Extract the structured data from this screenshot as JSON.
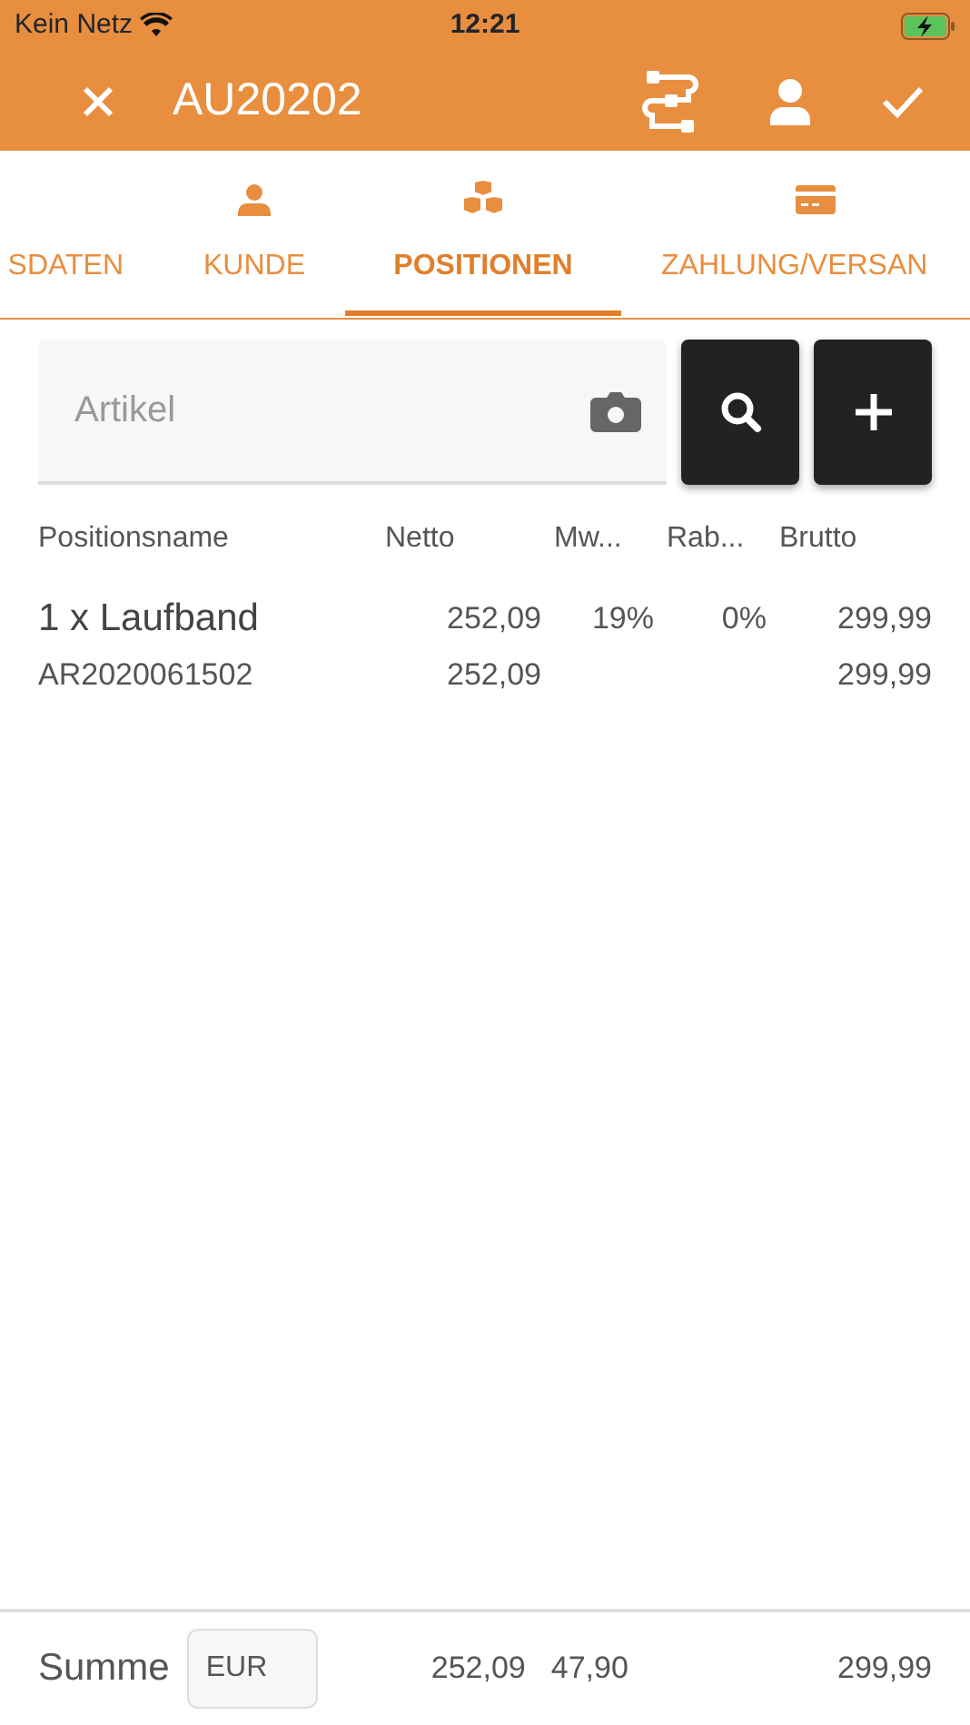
{
  "status_bar": {
    "carrier": "Kein Netz",
    "time": "12:21"
  },
  "header": {
    "title": "AU20202"
  },
  "tabs": [
    {
      "label": "SDATEN",
      "selected": false
    },
    {
      "label": "KUNDE",
      "selected": false
    },
    {
      "label": "POSITIONEN",
      "selected": true
    },
    {
      "label": "ZAHLUNG/VERSAN",
      "selected": false
    }
  ],
  "search": {
    "placeholder": "Artikel"
  },
  "table": {
    "columns": [
      "Positionsname",
      "Netto",
      "Mw...",
      "Rab...",
      "Brutto"
    ],
    "rows": [
      {
        "cells": [
          "1 x Laufband",
          "252,09",
          "19%",
          "0%",
          "299,99"
        ],
        "kind": "main"
      },
      {
        "cells": [
          "AR2020061502",
          "252,09",
          "",
          "",
          "299,99"
        ],
        "kind": "sub"
      }
    ]
  },
  "footer": {
    "label": "Summe",
    "currency": "EUR",
    "netto": "252,09",
    "tax": "47,90",
    "brutto": "299,99"
  }
}
